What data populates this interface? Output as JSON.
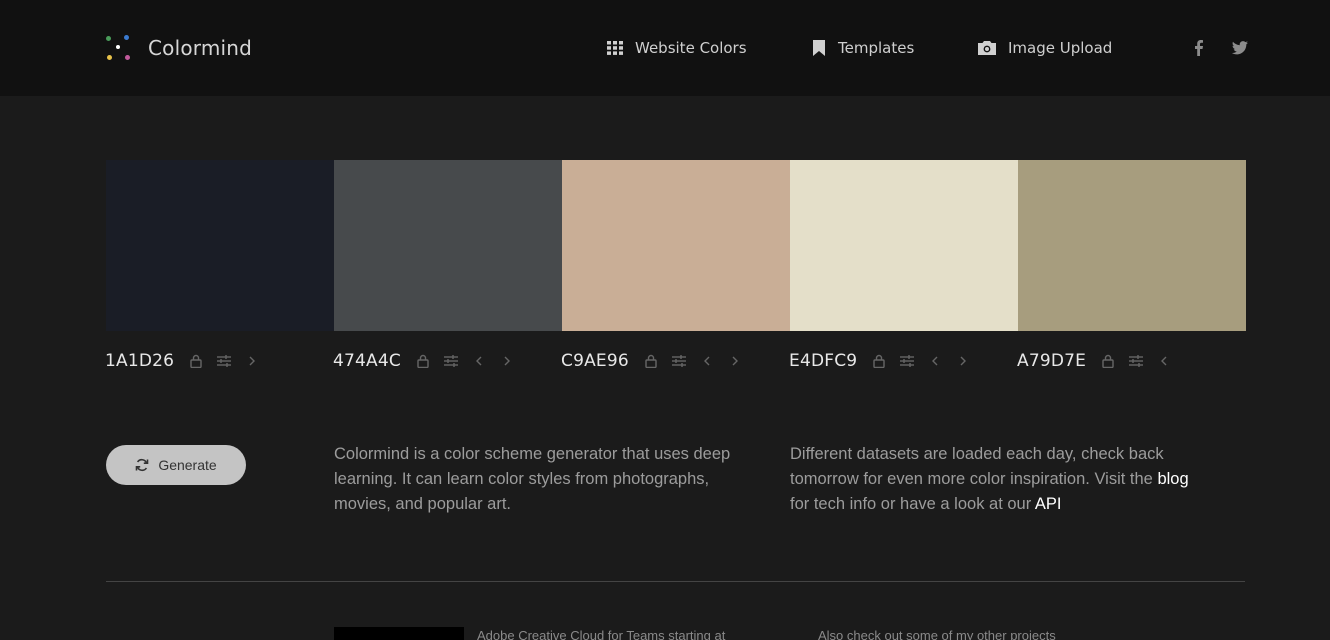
{
  "header": {
    "brand": "Colormind",
    "logo_dot_colors": [
      "#4a9c5a",
      "#3a7ad0",
      "#ffffff",
      "#e8c24a",
      "#c25a9c"
    ],
    "nav": [
      {
        "label": "Website Colors",
        "icon": "grid-icon"
      },
      {
        "label": "Templates",
        "icon": "bookmark-icon"
      },
      {
        "label": "Image Upload",
        "icon": "camera-icon"
      }
    ],
    "social": [
      "facebook-icon",
      "twitter-icon"
    ]
  },
  "palette": [
    {
      "hex": "1A1D26",
      "color": "#1A1D26",
      "controls": [
        "lock-icon",
        "adjust-icon",
        "chevron-right-icon"
      ]
    },
    {
      "hex": "474A4C",
      "color": "#474A4C",
      "controls": [
        "lock-icon",
        "adjust-icon",
        "chevron-left-icon",
        "chevron-right-icon"
      ]
    },
    {
      "hex": "C9AE96",
      "color": "#C9AE96",
      "controls": [
        "lock-icon",
        "adjust-icon",
        "chevron-left-icon",
        "chevron-right-icon"
      ]
    },
    {
      "hex": "E4DFC9",
      "color": "#E4DFC9",
      "controls": [
        "lock-icon",
        "adjust-icon",
        "chevron-left-icon",
        "chevron-right-icon"
      ]
    },
    {
      "hex": "A79D7E",
      "color": "#A79D7E",
      "controls": [
        "lock-icon",
        "adjust-icon",
        "chevron-left-icon"
      ]
    }
  ],
  "generate": {
    "label": "Generate",
    "icon": "refresh-icon"
  },
  "description": {
    "left": "Colormind is a color scheme generator that uses deep learning. It can learn color styles from photographs, movies, and popular art.",
    "right_prefix": "Different datasets are loaded each day, check back tomorrow for even more color inspiration. Visit the ",
    "blog_link": "blog",
    "right_middle": " for tech info or have a look at our ",
    "api_link": "API"
  },
  "footer": {
    "ad_text": "Adobe Creative Cloud for Teams starting at",
    "other_text": "Also check out some of my other projects"
  }
}
